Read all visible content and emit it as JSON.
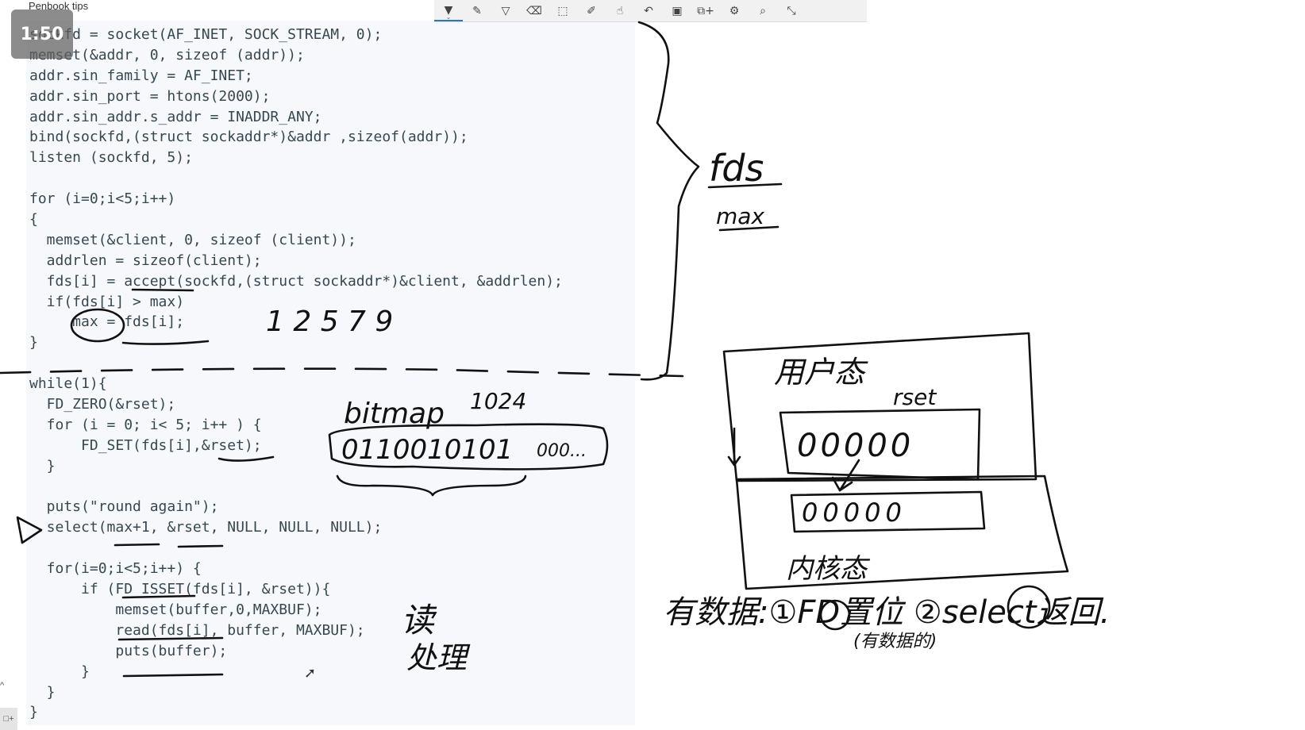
{
  "window": {
    "title": "Penbook tips"
  },
  "timer": {
    "text": "1:50"
  },
  "toolbar": {
    "tools": [
      {
        "name": "ballpoint-pen",
        "glyph": "▼"
      },
      {
        "name": "pencil",
        "glyph": "✎"
      },
      {
        "name": "highlighter",
        "glyph": "▽"
      },
      {
        "name": "eraser",
        "glyph": "⌫"
      },
      {
        "name": "lasso-select",
        "glyph": "⬚"
      },
      {
        "name": "ruler",
        "glyph": "✐"
      },
      {
        "name": "touch-writing",
        "glyph": "☝"
      },
      {
        "name": "undo",
        "glyph": "↶"
      },
      {
        "name": "insert-image",
        "glyph": "▣"
      },
      {
        "name": "add-page",
        "glyph": "⧉+"
      },
      {
        "name": "settings",
        "glyph": "⚙"
      },
      {
        "name": "search",
        "glyph": "⌕"
      },
      {
        "name": "exit-fullscreen",
        "glyph": "⤡"
      }
    ]
  },
  "code": {
    "lines": [
      "sockfd = socket(AF_INET, SOCK_STREAM, 0);",
      "memset(&addr, 0, sizeof (addr));",
      "addr.sin_family = AF_INET;",
      "addr.sin_port = htons(2000);",
      "addr.sin_addr.s_addr = INADDR_ANY;",
      "bind(sockfd,(struct sockaddr*)&addr ,sizeof(addr));",
      "listen (sockfd, 5);",
      "",
      "for (i=0;i<5;i++)",
      "{",
      "  memset(&client, 0, sizeof (client));",
      "  addrlen = sizeof(client);",
      "  fds[i] = accept(sockfd,(struct sockaddr*)&client, &addrlen);",
      "  if(fds[i] > max)",
      "     max = fds[i];",
      "}",
      "",
      "while(1){",
      "  FD_ZERO(&rset);",
      "  for (i = 0; i< 5; i++ ) {",
      "      FD_SET(fds[i],&rset);",
      "  }",
      "",
      "  puts(\"round again\");",
      "  select(max+1, &rset, NULL, NULL, NULL);",
      "",
      "  for(i=0;i<5;i++) {",
      "      if (FD_ISSET(fds[i], &rset)){",
      "          memset(buffer,0,MAXBUF);",
      "          read(fds[i], buffer, MAXBUF);",
      "          puts(buffer);",
      "      }",
      "  }",
      "}"
    ]
  },
  "annotations": {
    "fds": "fds",
    "max": "max",
    "numbers": "1 2 5 7 9",
    "bitmap": "bitmap",
    "bitmap_size": "1024",
    "bits": "0110010101",
    "bits_tail": "000...",
    "read_label": "读",
    "process_label": "处理",
    "user_mode": "用户态",
    "rset": "rset",
    "user_bits": "00000",
    "kernel_bits": "00000",
    "kernel_mode": "内核态",
    "summary": "有数据:①FD置位 ②select返回.",
    "summary_note": "(有数据的)"
  }
}
